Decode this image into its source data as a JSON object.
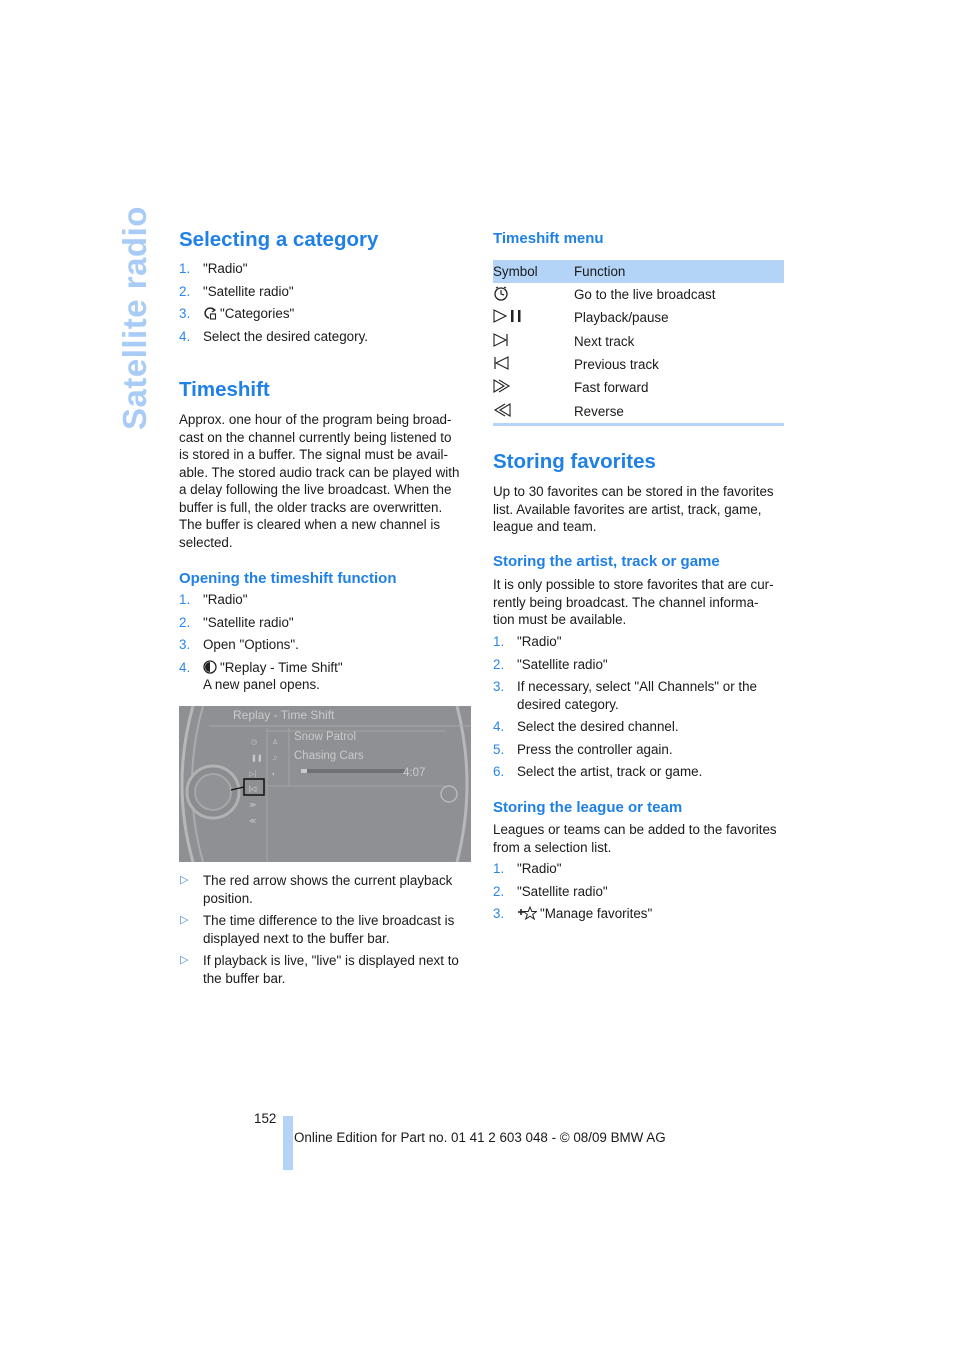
{
  "side_title": "Satellite radio",
  "left": {
    "selecting_category": {
      "heading": "Selecting a category",
      "steps": [
        {
          "num": "1.",
          "text": "\"Radio\""
        },
        {
          "num": "2.",
          "text": "\"Satellite radio\""
        },
        {
          "num": "3.",
          "icon": "categories-icon",
          "text": "\"Categories\""
        },
        {
          "num": "4.",
          "text": "Select the desired category."
        }
      ]
    },
    "timeshift": {
      "heading": "Timeshift",
      "body_lines": [
        "Approx. one hour of the program being broad-",
        "cast on the channel currently being listened to",
        "is stored in a buffer. The signal must be avail-",
        "able. The stored audio track can be played with",
        "a delay following the live broadcast. When the",
        "buffer is full, the older tracks are overwritten.",
        "The buffer is cleared when a new channel is",
        "selected."
      ]
    },
    "opening_timeshift": {
      "heading": "Opening the timeshift function",
      "steps": [
        {
          "num": "1.",
          "text": "\"Radio\""
        },
        {
          "num": "2.",
          "text": "\"Satellite radio\""
        },
        {
          "num": "3.",
          "text": "Open \"Options\"."
        },
        {
          "num": "4.",
          "icon": "replay-icon",
          "text": "\"Replay - Time Shift\"",
          "subtext": "A new panel opens."
        }
      ]
    },
    "screen": {
      "title": "Replay - Time Shift",
      "artist": "Snow Patrol",
      "track": "Chasing Cars",
      "time": "4:07",
      "buffer_progress": 0.05,
      "menu_icons": [
        "live-icon",
        "pause-icon",
        "next-track-icon",
        "previous-track-icon",
        "fast-forward-icon",
        "reverse-icon"
      ],
      "selected_icon": "previous-track-icon"
    },
    "notes": [
      "The red arrow shows the current playback position.",
      "The time difference to the live broadcast is displayed next to the buffer bar.",
      "If playback is live, \"live\" is displayed next to the buffer bar."
    ]
  },
  "right": {
    "timeshift_menu": {
      "heading": "Timeshift menu",
      "columns": [
        "Symbol",
        "Function"
      ],
      "rows": [
        {
          "symbol": "live-broadcast-icon",
          "function": "Go to the live broadcast"
        },
        {
          "symbol": "play-pause-icon",
          "function": "Playback/pause"
        },
        {
          "symbol": "next-track-icon",
          "function": "Next track"
        },
        {
          "symbol": "previous-track-icon",
          "function": "Previous track"
        },
        {
          "symbol": "fast-forward-icon",
          "function": "Fast forward"
        },
        {
          "symbol": "reverse-icon",
          "function": "Reverse"
        }
      ]
    },
    "storing_favorites": {
      "heading": "Storing favorites",
      "body_lines": [
        "Up to 30 favorites can be stored in the favorites",
        "list. Available favorites are artist, track, game,",
        "league and team."
      ]
    },
    "storing_artist": {
      "heading": "Storing the artist, track or game",
      "body_lines": [
        "It is only possible to store favorites that are cur-",
        "rently being broadcast. The channel informa-",
        "tion must be available."
      ],
      "steps": [
        {
          "num": "1.",
          "text": "\"Radio\""
        },
        {
          "num": "2.",
          "text": "\"Satellite radio\""
        },
        {
          "num": "3.",
          "text": "If necessary, select \"All Channels\" or the desired category."
        },
        {
          "num": "4.",
          "text": "Select the desired channel."
        },
        {
          "num": "5.",
          "text": "Press the controller again."
        },
        {
          "num": "6.",
          "text": "Select the artist, track or game."
        }
      ]
    },
    "storing_league": {
      "heading": "Storing the league or team",
      "body_lines": [
        "Leagues or teams can be added to the favorites",
        "from a selection list."
      ],
      "steps": [
        {
          "num": "1.",
          "text": "\"Radio\""
        },
        {
          "num": "2.",
          "text": "\"Satellite radio\""
        },
        {
          "num": "3.",
          "icon": "manage-favorites-icon",
          "text": "\"Manage favorites\""
        }
      ]
    }
  },
  "footer": {
    "page_number": "152",
    "text": "Online Edition for Part no. 01 41 2 603 048 - © 08/09 BMW AG"
  }
}
